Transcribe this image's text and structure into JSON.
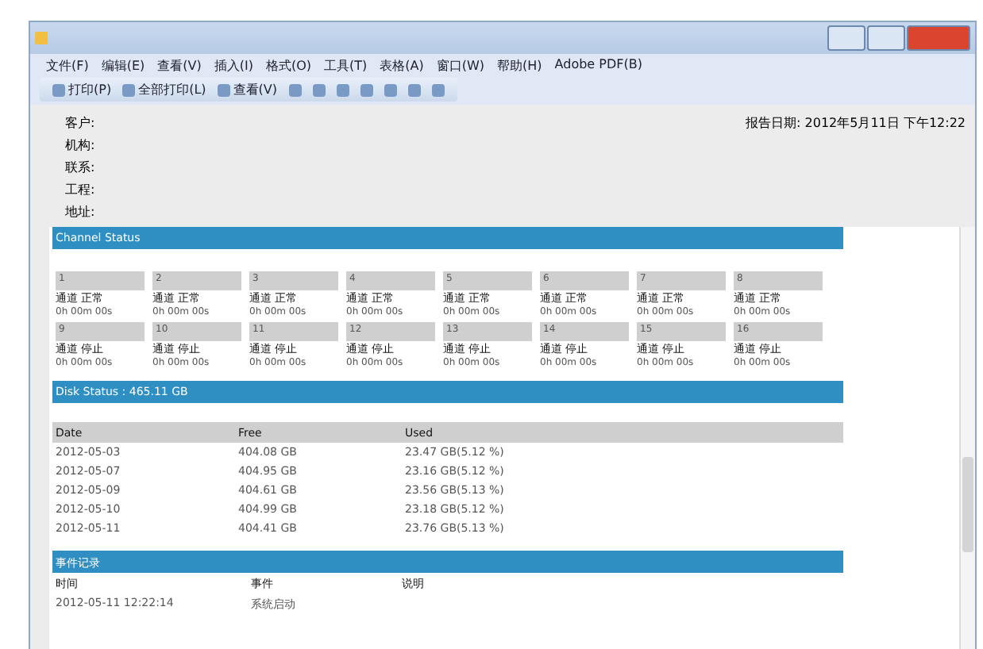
{
  "menu": [
    "文件(F)",
    "编辑(E)",
    "查看(V)",
    "插入(I)",
    "格式(O)",
    "工具(T)",
    "表格(A)",
    "窗口(W)",
    "帮助(H)",
    "Adobe PDF(B)"
  ],
  "toolbar": [
    {
      "kind": "text",
      "label": "打印(P)"
    },
    {
      "kind": "text",
      "label": "全部打印(L)"
    },
    {
      "kind": "text",
      "label": "查看(V)"
    },
    {
      "kind": "icon"
    },
    {
      "kind": "icon"
    },
    {
      "kind": "icon"
    },
    {
      "kind": "icon"
    },
    {
      "kind": "icon"
    },
    {
      "kind": "icon"
    },
    {
      "kind": "icon"
    }
  ],
  "header": {
    "fields": [
      "客户:",
      "机构:",
      "联系:",
      "工程:",
      "地址:"
    ],
    "report_date": "报告日期: 2012年5月11日 下午12:22"
  },
  "channel_section": {
    "title": "Channel Status",
    "channels": [
      {
        "number": "1",
        "status": "通道 正常",
        "time": "0h 00m 00s"
      },
      {
        "number": "2",
        "status": "通道 正常",
        "time": "0h 00m 00s"
      },
      {
        "number": "3",
        "status": "通道 正常",
        "time": "0h 00m 00s"
      },
      {
        "number": "4",
        "status": "通道 正常",
        "time": "0h 00m 00s"
      },
      {
        "number": "5",
        "status": "通道 正常",
        "time": "0h 00m 00s"
      },
      {
        "number": "6",
        "status": "通道 正常",
        "time": "0h 00m 00s"
      },
      {
        "number": "7",
        "status": "通道 正常",
        "time": "0h 00m 00s"
      },
      {
        "number": "8",
        "status": "通道 正常",
        "time": "0h 00m 00s"
      },
      {
        "number": "9",
        "status": "通道 停止",
        "time": "0h 00m 00s"
      },
      {
        "number": "10",
        "status": "通道 停止",
        "time": "0h 00m 00s"
      },
      {
        "number": "11",
        "status": "通道 停止",
        "time": "0h 00m 00s"
      },
      {
        "number": "12",
        "status": "通道 停止",
        "time": "0h 00m 00s"
      },
      {
        "number": "13",
        "status": "通道 停止",
        "time": "0h 00m 00s"
      },
      {
        "number": "14",
        "status": "通道 停止",
        "time": "0h 00m 00s"
      },
      {
        "number": "15",
        "status": "通道 停止",
        "time": "0h 00m 00s"
      },
      {
        "number": "16",
        "status": "通道 停止",
        "time": "0h 00m 00s"
      }
    ]
  },
  "disk_section": {
    "title": "Disk Status : 465.11 GB",
    "columns": [
      "Date",
      "Free",
      "Used"
    ],
    "rows": [
      [
        "2012-05-03",
        "404.08 GB",
        "23.47 GB(5.12 %)"
      ],
      [
        "2012-05-07",
        "404.95 GB",
        "23.16 GB(5.12 %)"
      ],
      [
        "2012-05-09",
        "404.61 GB",
        "23.56 GB(5.13 %)"
      ],
      [
        "2012-05-10",
        "404.99 GB",
        "23.18 GB(5.12 %)"
      ],
      [
        "2012-05-11",
        "404.41 GB",
        "23.76 GB(5.13 %)"
      ]
    ]
  },
  "event_section": {
    "title": "事件记录",
    "columns": [
      "时间",
      "事件",
      "说明"
    ],
    "rows": [
      [
        "2012-05-11 12:22:14",
        "系统启动",
        ""
      ]
    ]
  }
}
